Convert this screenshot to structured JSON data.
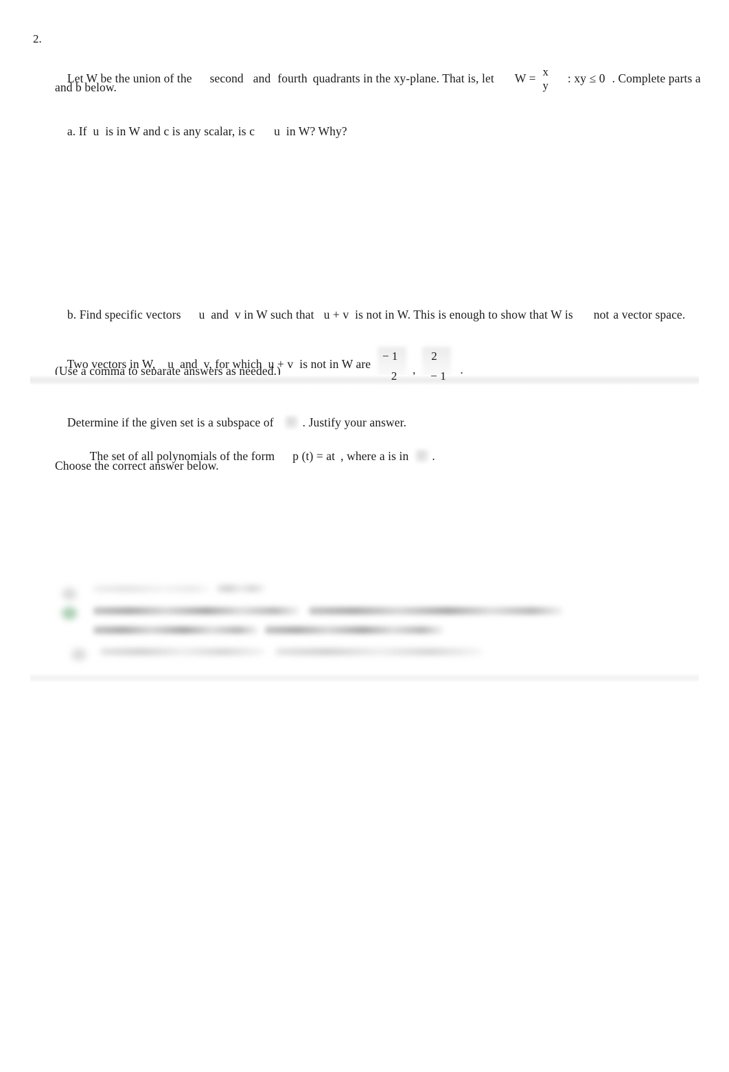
{
  "document": {
    "question_number": "2.",
    "background_color": "#ffffff",
    "text_color": "#1a1a1a"
  },
  "problem": {
    "stem_part1": "Let W be the union of the",
    "stem_quadrant1": "second",
    "stem_and": "and",
    "stem_quadrant2": "fourth",
    "stem_part2": "quadrants in the xy-plane. That is, let",
    "set_label": "W =",
    "vector_top": "x",
    "vector_bottom": "y",
    "condition": ": xy ≤ 0",
    "stem_part3": ". Complete parts a",
    "stem_line2": "and b below."
  },
  "part_a": {
    "label": "a. If  u  is in W and c is any scalar, is c",
    "label_tail": "u  in W? Why?"
  },
  "part_b": {
    "prompt_1": "b. Find specific vectors",
    "prompt_2": "u  and  v in W such that",
    "prompt_3": "u + v  is not in W. This is enough to show that W is",
    "prompt_emph": "not",
    "prompt_4": "a vector space.",
    "answer_prefix": "Two vectors in W,    u  and  v, for which  u + v  is not in W are",
    "vector_u": {
      "top": "− 1",
      "bottom": "2"
    },
    "separator": ",",
    "vector_v": {
      "top": "2",
      "bottom": "− 1"
    },
    "period": ".",
    "hint": "(Use a comma to separate answers as needed.)"
  },
  "part_c": {
    "instruction_1": "Determine if the given set is a subspace of",
    "redacted_space_icon": "blurred-symbol",
    "instruction_2": ". Justify your answer.",
    "set_description_1": "The set of all polynomials of the form",
    "set_description_2": "p (t) = at",
    "set_description_3": ", where a is in",
    "redacted_field_icon": "blurred-symbol",
    "set_description_4": ".",
    "choose_prompt": "Choose the correct answer below.",
    "options": [
      {
        "id": "option-a",
        "state": "unselected",
        "content": "redacted"
      },
      {
        "id": "option-b",
        "state": "selected",
        "accent": "#74ae84",
        "content": "redacted"
      },
      {
        "id": "option-c",
        "state": "unselected",
        "content": "redacted"
      }
    ]
  },
  "dividers": {
    "upper_band_color": "#ececed",
    "lower_band_color": "#f3f3f4"
  }
}
